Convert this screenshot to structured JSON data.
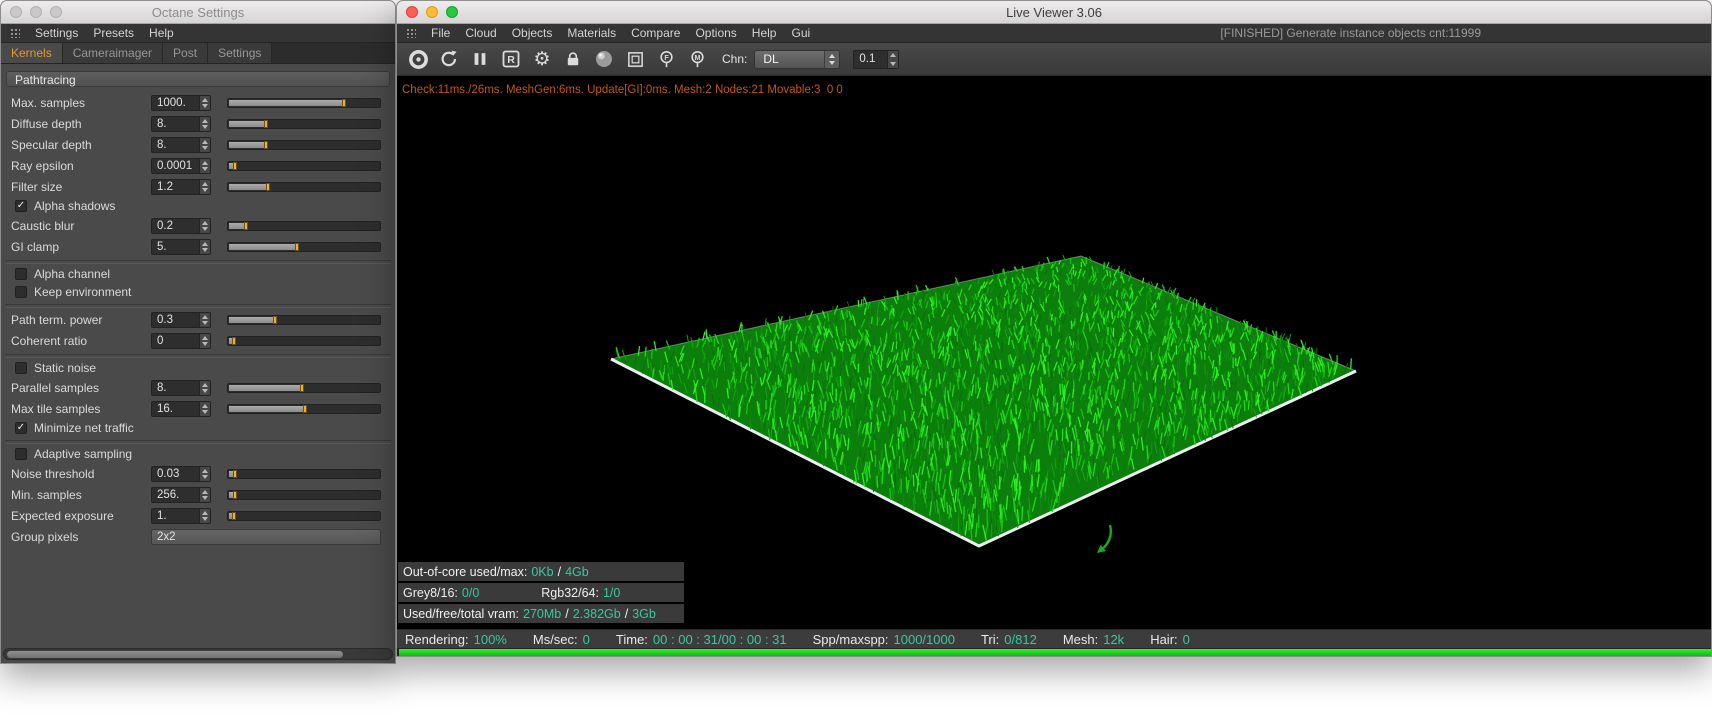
{
  "octane": {
    "window_title": "Octane Settings",
    "menu": [
      {
        "label": "Settings"
      },
      {
        "label": "Presets"
      },
      {
        "label": "Help"
      }
    ],
    "tabs": [
      {
        "label": "Kernels",
        "active": true
      },
      {
        "label": "Cameraimager",
        "active": false
      },
      {
        "label": "Post",
        "active": false
      },
      {
        "label": "Settings",
        "active": false
      }
    ],
    "section_header": "Pathtracing",
    "rows": [
      {
        "type": "param",
        "label": "Max. samples",
        "value": "1000.",
        "fraction": 0.77
      },
      {
        "type": "param",
        "label": "Diffuse depth",
        "value": "8.",
        "fraction": 0.24
      },
      {
        "type": "param",
        "label": "Specular depth",
        "value": "8.",
        "fraction": 0.24
      },
      {
        "type": "param",
        "label": "Ray epsilon",
        "value": "0.0001",
        "fraction": 0.03
      },
      {
        "type": "param",
        "label": "Filter size",
        "value": "1.2",
        "fraction": 0.25
      },
      {
        "type": "check",
        "label": "Alpha shadows",
        "checked": true
      },
      {
        "type": "param",
        "label": "Caustic blur",
        "value": "0.2",
        "fraction": 0.1
      },
      {
        "type": "param",
        "label": "GI clamp",
        "value": "5.",
        "fraction": 0.45
      },
      {
        "type": "divider"
      },
      {
        "type": "check",
        "label": "Alpha channel",
        "checked": false
      },
      {
        "type": "check",
        "label": "Keep environment",
        "checked": false
      },
      {
        "type": "divider"
      },
      {
        "type": "param",
        "label": "Path term. power",
        "value": "0.3",
        "fraction": 0.3
      },
      {
        "type": "param",
        "label": "Coherent ratio",
        "value": "0",
        "fraction": 0.02
      },
      {
        "type": "divider"
      },
      {
        "type": "check",
        "label": "Static noise",
        "checked": false
      },
      {
        "type": "param",
        "label": "Parallel samples",
        "value": "8.",
        "fraction": 0.48
      },
      {
        "type": "param",
        "label": "Max tile samples",
        "value": "16.",
        "fraction": 0.5
      },
      {
        "type": "check",
        "label": "Minimize net traffic",
        "checked": true
      },
      {
        "type": "divider"
      },
      {
        "type": "check",
        "label": "Adaptive sampling",
        "checked": false
      },
      {
        "type": "param",
        "label": "Noise threshold",
        "value": "0.03",
        "fraction": 0.03
      },
      {
        "type": "param",
        "label": "Min. samples",
        "value": "256.",
        "fraction": 0.03
      },
      {
        "type": "param",
        "label": "Expected exposure",
        "value": "1.",
        "fraction": 0.02
      },
      {
        "type": "wide",
        "label": "Group pixels",
        "value": "2x2"
      }
    ]
  },
  "viewer": {
    "window_title": "Live Viewer 3.06",
    "menu": [
      {
        "label": "File"
      },
      {
        "label": "Cloud"
      },
      {
        "label": "Objects"
      },
      {
        "label": "Materials"
      },
      {
        "label": "Compare"
      },
      {
        "label": "Options"
      },
      {
        "label": "Help"
      },
      {
        "label": "Gui"
      }
    ],
    "menu_status": "[FINISHED] Generate instance objects cnt:11999",
    "toolbar": {
      "region_letter": "R",
      "pick_focus_letter": "F",
      "pick_material_letter": "M",
      "chn_label": "Chn:",
      "chn_value": "DL",
      "scale_value": "0.1"
    },
    "perf_line": "Check:11ms./26ms. MeshGen:6ms. Update[GI]:0ms. Mesh:2 Nodes:21 Movable:3  0 0",
    "overlay": {
      "row1": {
        "label": "Out-of-core used/max:",
        "v1": "0Kb",
        "sep1": "/",
        "v2": "4Gb"
      },
      "row2": {
        "label_a": "Grey8/16:",
        "val_a": "0/0",
        "label_b": "Rgb32/64:",
        "val_b": "1/0"
      },
      "row3": {
        "label": "Used/free/total vram:",
        "v1": "270Mb",
        "sep1": "/",
        "v2": "2.382Gb",
        "sep2": "/",
        "v3": "3Gb"
      }
    },
    "statusbar": [
      {
        "label": "Rendering:",
        "value": "100%"
      },
      {
        "label": "Ms/sec:",
        "value": "0"
      },
      {
        "label": "Time:",
        "value": "00 : 00 : 31/00 : 00 : 31"
      },
      {
        "label": "Spp/maxspp:",
        "value": "1000/1000"
      },
      {
        "label": "Tri:",
        "value": "0/812"
      },
      {
        "label": "Mesh:",
        "value": "12k"
      },
      {
        "label": "Hair:",
        "value": "0"
      }
    ],
    "colors": {
      "value_teal": "#36c9a0",
      "perf_orange": "#c45a00",
      "progress_green": "#1ee11e",
      "grass_green": "#13ab10"
    }
  }
}
